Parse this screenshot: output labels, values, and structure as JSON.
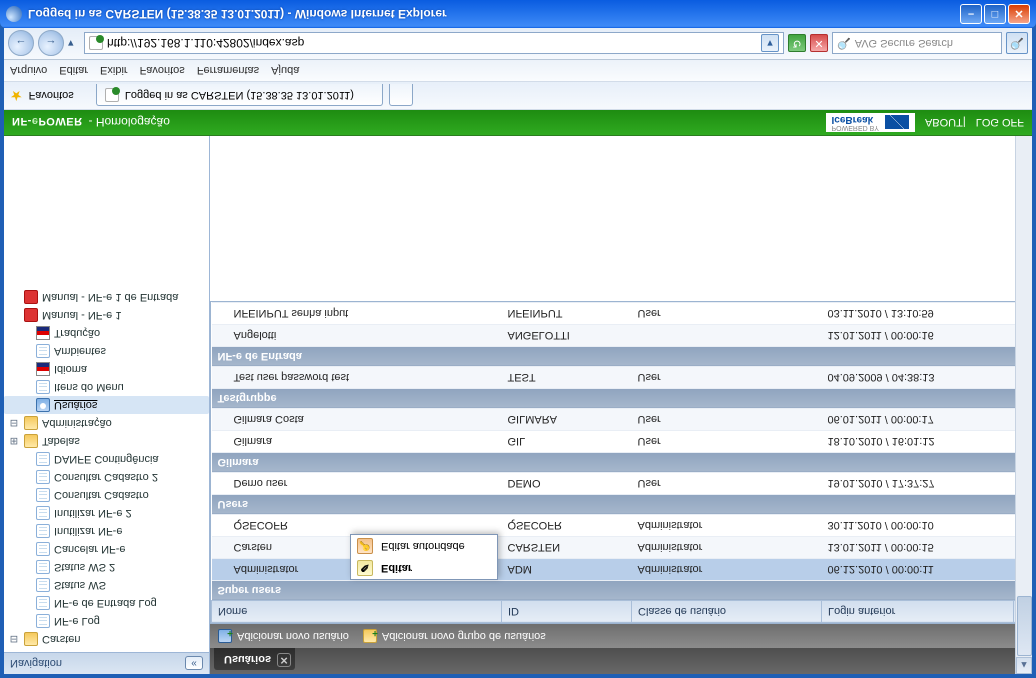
{
  "window": {
    "title": "Logged in as CARSTEN (15.38.35 13.01.2011) - Windows Internet Explorer"
  },
  "address": {
    "url": "http://192.168.1.110:42802/index.asp",
    "search_placeholder": "AVG Secure Search"
  },
  "menus": [
    "Arquivo",
    "Editar",
    "Exibir",
    "Favoritos",
    "Ferramentas",
    "Ajuda"
  ],
  "favbar": {
    "label": "Favoritos",
    "tab": "Logged in as CARSTEN (15.38.35 13.01.2011)"
  },
  "brand": {
    "name_a": "NF-",
    "name_b": "e",
    "name_c": "POWER",
    "subtitle": "- Homologação",
    "icebreak_t": "POWERED BY",
    "icebreak": "IceBreak",
    "about": "ABOUT",
    "logoff": "LOG OFF"
  },
  "sidebar": {
    "title": "Navigation",
    "nodes": {
      "carsten": "Carsten",
      "nfelog": "NF-e Log",
      "nfeentlog": "NF-e de Entrada Log",
      "statusws": "Status WS",
      "statusws2": "Status WS 2",
      "cancelar": "Cancelar NF-e",
      "inutilizar": "Inutilizar NF-e",
      "inutilizar2": "Inutilizar NF-e 2",
      "cad": "Consultar Cadastro",
      "cad2": "Consultar Cadastro 2",
      "danfe": "DANFE Contingência",
      "tabelas": "Tabelas",
      "admin": "Administração",
      "usuarios": "Usuários",
      "itensmenu": "Itens do Menu",
      "idioma": "Idioma",
      "ambientes": "Ambientes",
      "traducao": "Tradução",
      "manual1": "Manual - NF-e 1",
      "manual2": "Manual - NF-e 1 de Entrada"
    }
  },
  "maintab": "Usuários",
  "toolbar": {
    "add_user": "Adicionar novo usuário",
    "add_group": "Adicionar novo grupo de usuários"
  },
  "columns": {
    "c0": "Nome",
    "c1": "ID",
    "c2": "Classe de usuário",
    "c3": "Login anterior"
  },
  "groups": {
    "g0": "Super users",
    "g1": "Users",
    "g2": "Gilmara",
    "g3": "Testgruppe",
    "g4": "NF-e de Entrada"
  },
  "rows": {
    "r0": {
      "nome": "Administrator",
      "id": "ADM",
      "classe": "Administrator",
      "login": "06.12.2010 / 00:00:11"
    },
    "r1": {
      "nome": "Carsten",
      "id": "CARSTEN",
      "classe": "Administrator",
      "login": "13.01.2011 / 00:00:15"
    },
    "r2": {
      "nome": "QSECOFR",
      "id": "QSECOFR",
      "classe": "Administrator",
      "login": "30.11.2010 / 00:00:10"
    },
    "r3": {
      "nome": "Demo user",
      "id": "DEMO",
      "classe": "User",
      "login": "19.01.2010 / 17:37:27"
    },
    "r4": {
      "nome": "Gilmara Costa",
      "id": "GILMARA",
      "classe": "User",
      "login": "06.01.2011 / 00:00:17"
    },
    "r5": {
      "nome": "Test user password test",
      "id": "TEST",
      "classe": "User",
      "login": "04.09.2009 / 04:38:13"
    },
    "r6": {
      "nome": "Gilmara",
      "id": "GIL",
      "classe": "User",
      "login": "18.10.2010 / 16:01:12"
    },
    "r7": {
      "nome": "Angelotti",
      "id": "ANGELOTTI",
      "classe": "",
      "login": "12.01.2011 / 00:00:16"
    },
    "r8": {
      "nome": "NFEINPUT senha input",
      "id": "NFEINPUT",
      "classe": "User",
      "login": "03.11.2010 / 13:10:59"
    }
  },
  "context": {
    "editar": "Editar",
    "editar_aut": "Editar autoridade"
  }
}
